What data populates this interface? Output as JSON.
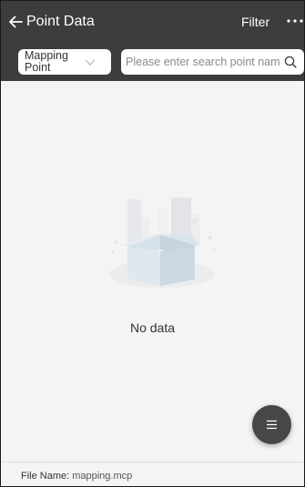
{
  "header": {
    "back_icon": "arrow-left",
    "title": "Point Data",
    "filter_label": "Filter",
    "more_icon": "more-horizontal"
  },
  "toolbar": {
    "point_type": "Mapping Point",
    "search_placeholder": "Please enter search point name",
    "search_icon": "search"
  },
  "empty_state": {
    "icon": "empty-box",
    "message": "No data"
  },
  "fab": {
    "icon": "menu"
  },
  "footer": {
    "file_label": "File Name:",
    "file_name": "mapping.mcp"
  },
  "colors": {
    "header_bg": "#3d3d3d",
    "page_bg": "#f4f4f4",
    "fab_bg": "#474747"
  }
}
